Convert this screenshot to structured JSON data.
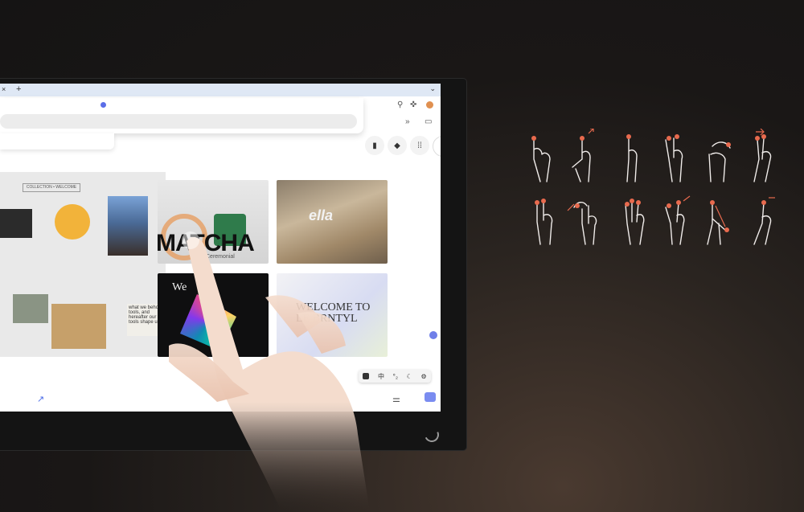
{
  "browser": {
    "tab_close": "×",
    "tab_new": "+",
    "tab_menu": "⌄",
    "toolbar_overflow": "»"
  },
  "collage": {
    "label": "COLLECTION • WELCOME",
    "note": "what we behold\ntools, and\nhereafter our tools shape us"
  },
  "cards": {
    "matcha_title": "MATCHA",
    "matcha_subtitle": "Ceremonial",
    "beach_title": "ella",
    "dark_title": "We",
    "welcome_title": "WELCOME TO\nLE BRNTYL"
  },
  "ime_toolbar": [
    "中",
    "°₂",
    "☾",
    "⚙"
  ],
  "colors": {
    "accent_touch": "#e86a4e",
    "hand_skin": "#f1d3c2",
    "bg_dark": "#1a1716"
  },
  "gesture_icons": [
    "one-finger-tap-icon",
    "one-finger-press-icon",
    "one-finger-swipe-up-icon",
    "two-finger-tap-icon",
    "rotate-icon",
    "two-finger-swipe-icon",
    "pinch-in-icon",
    "hand-rotate-icon",
    "three-finger-tap-icon",
    "three-finger-spread-icon",
    "two-finger-drag-icon",
    "swipe-right-icon"
  ]
}
